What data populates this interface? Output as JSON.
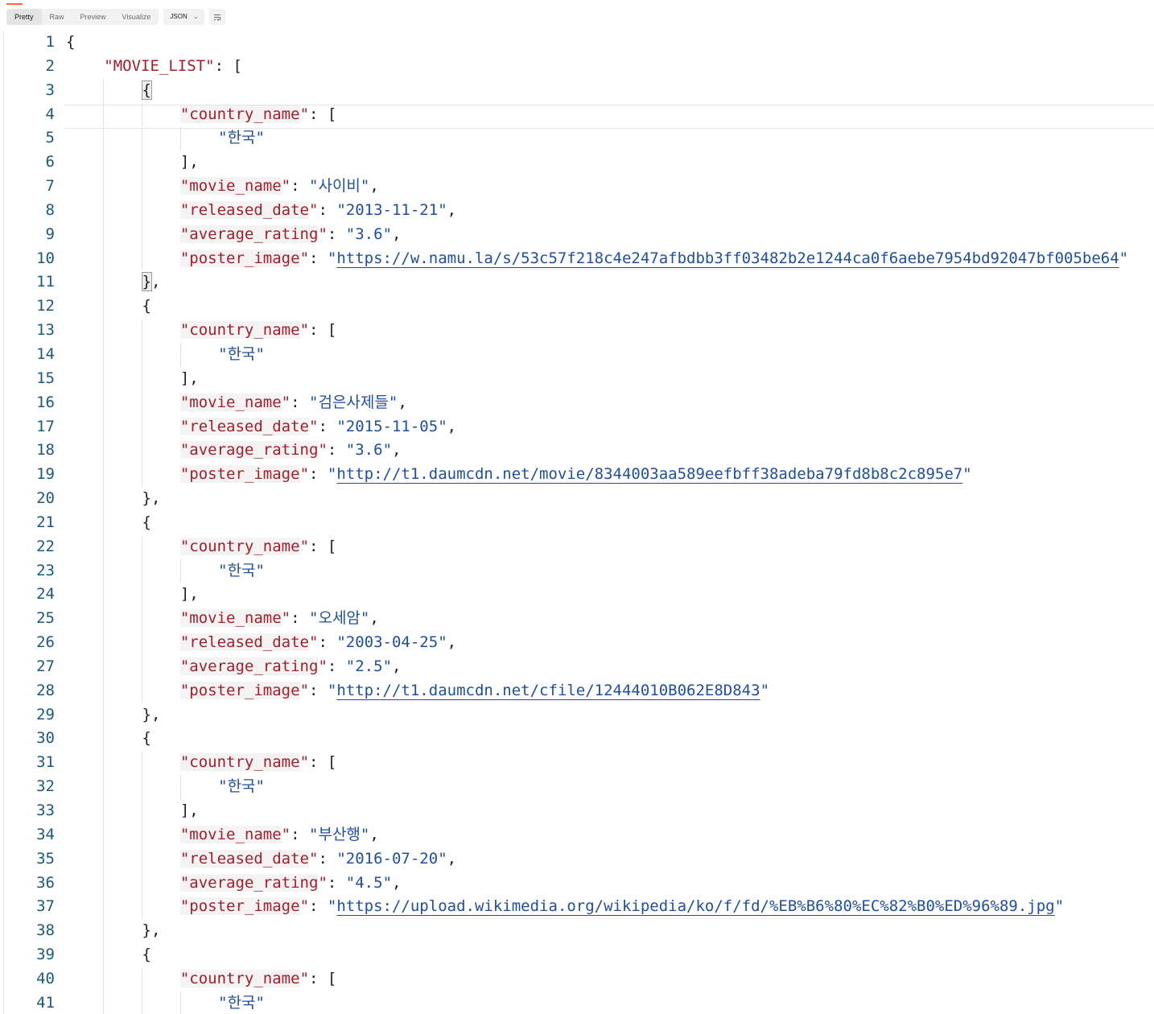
{
  "toolbar": {
    "tabs": [
      "Pretty",
      "Raw",
      "Preview",
      "Visualize"
    ],
    "active_tab": "Pretty",
    "format": "JSON"
  },
  "json_body": {
    "root_key": "MOVIE_LIST",
    "movies": [
      {
        "country_name": [
          "한국"
        ],
        "movie_name": "사이비",
        "released_date": "2013-11-21",
        "average_rating": "3.6",
        "poster_image": "https://w.namu.la/s/53c57f218c4e247afbdbb3ff03482b2e1244ca0f6aebe7954bd92047bf005be64"
      },
      {
        "country_name": [
          "한국"
        ],
        "movie_name": "검은사제들",
        "released_date": "2015-11-05",
        "average_rating": "3.6",
        "poster_image": "http://t1.daumcdn.net/movie/8344003aa589eefbff38adeba79fd8b8c2c895e7"
      },
      {
        "country_name": [
          "한국"
        ],
        "movie_name": "오세암",
        "released_date": "2003-04-25",
        "average_rating": "2.5",
        "poster_image": "http://t1.daumcdn.net/cfile/12444010B062E8D843"
      },
      {
        "country_name": [
          "한국"
        ],
        "movie_name": "부산행",
        "released_date": "2016-07-20",
        "average_rating": "4.5",
        "poster_image": "https://upload.wikimedia.org/wikipedia/ko/f/fd/%EB%B6%80%EC%82%B0%ED%96%89.jpg"
      },
      {
        "country_name": [
          "한국"
        ]
      }
    ]
  },
  "colors": {
    "brand_accent": "#FF6C37",
    "json_key": "#A41E2A",
    "json_string": "#1F4FA1",
    "line_number": "#1C5A7A"
  }
}
